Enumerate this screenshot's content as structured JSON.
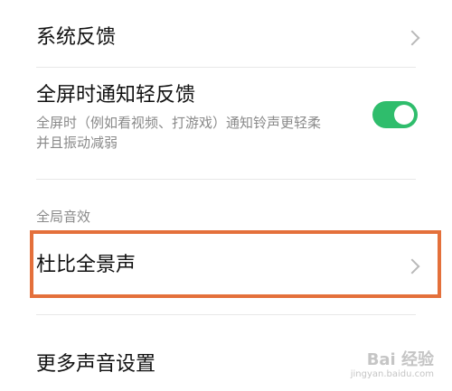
{
  "colors": {
    "toggle_on": "#2fbd6c",
    "highlight": "#e4703b"
  },
  "settings": {
    "system_feedback": {
      "label": "系统反馈",
      "icon": "chevron-right-icon"
    },
    "fullscreen_notify": {
      "label": "全屏时通知轻反馈",
      "description_line1": "全屏时（例如看视频、打游戏）通知铃声更轻柔",
      "description_line2": "并且振动减弱",
      "enabled": true
    },
    "global_sound_section": {
      "label": "全局音效"
    },
    "dolby_atmos": {
      "label": "杜比全景声",
      "icon": "chevron-right-icon"
    },
    "more_sound_settings": {
      "label": "更多声音设置"
    }
  },
  "watermark": {
    "text": "Bai 经验",
    "url": "jingyan.baidu.com"
  }
}
